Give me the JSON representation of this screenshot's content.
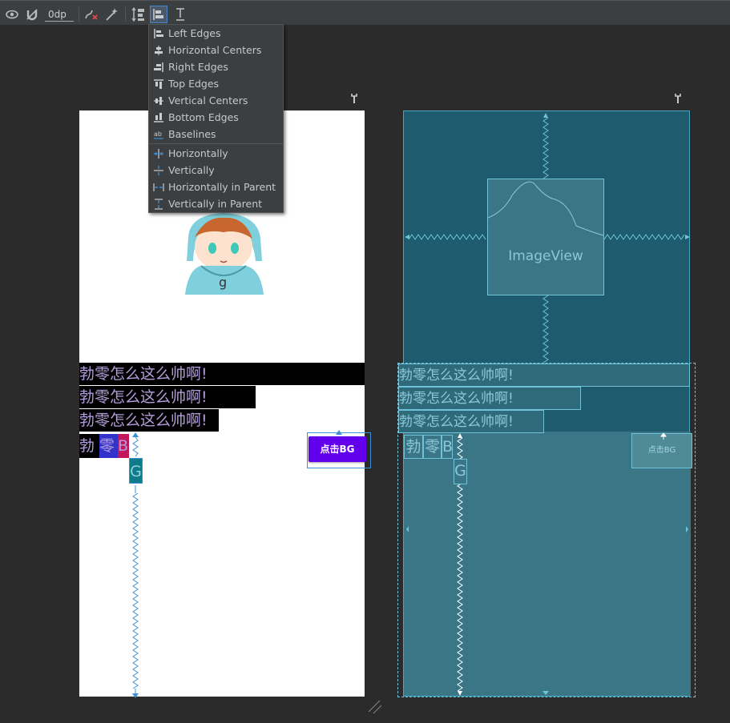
{
  "toolbar": {
    "margin_value": "0dp",
    "icons": [
      "eye-icon",
      "magnet-off-icon",
      "clear-constraints-icon",
      "infer-constraints-icon",
      "pack-icon",
      "align-icon",
      "guidelines-icon"
    ]
  },
  "align_menu": {
    "items": [
      {
        "label": "Left Edges",
        "icon": "align-left-edges-icon"
      },
      {
        "label": "Horizontal Centers",
        "icon": "align-horizontal-centers-icon"
      },
      {
        "label": "Right Edges",
        "icon": "align-right-edges-icon"
      },
      {
        "label": "Top Edges",
        "icon": "align-top-edges-icon"
      },
      {
        "label": "Vertical Centers",
        "icon": "align-vertical-centers-icon"
      },
      {
        "label": "Bottom Edges",
        "icon": "align-bottom-edges-icon"
      },
      {
        "label": "Baselines",
        "icon": "align-baselines-icon"
      },
      {
        "label": "Horizontally",
        "icon": "center-horizontally-icon"
      },
      {
        "label": "Vertically",
        "icon": "center-vertically-icon"
      },
      {
        "label": "Horizontally in Parent",
        "icon": "center-horizontally-parent-icon"
      },
      {
        "label": "Vertically in Parent",
        "icon": "center-vertically-parent-icon"
      }
    ]
  },
  "design": {
    "text_rows": [
      "勃零怎么这么帅啊!",
      "勃零怎么这么帅啊!",
      "勃零怎么这么帅啊!"
    ],
    "chips": [
      "勃",
      "零",
      "B"
    ],
    "g_label": "G",
    "button_label": "点击BG"
  },
  "blueprint": {
    "imageview_label": "ImageView",
    "text_rows": [
      "勃零怎么这么帅啊!",
      "勃零怎么这么帅啊!",
      "勃零怎么这么帅啊!"
    ],
    "chips": [
      "勃",
      "零",
      "B"
    ],
    "g_label": "G",
    "button_label": "点击BG"
  },
  "colors": {
    "toolbar_bg": "#3c3f41",
    "canvas_bg": "#2b2b2b",
    "blueprint_bg": "#1f5b6e",
    "button_purple": "#6200ee",
    "accent_blue": "#3d8fd8"
  }
}
